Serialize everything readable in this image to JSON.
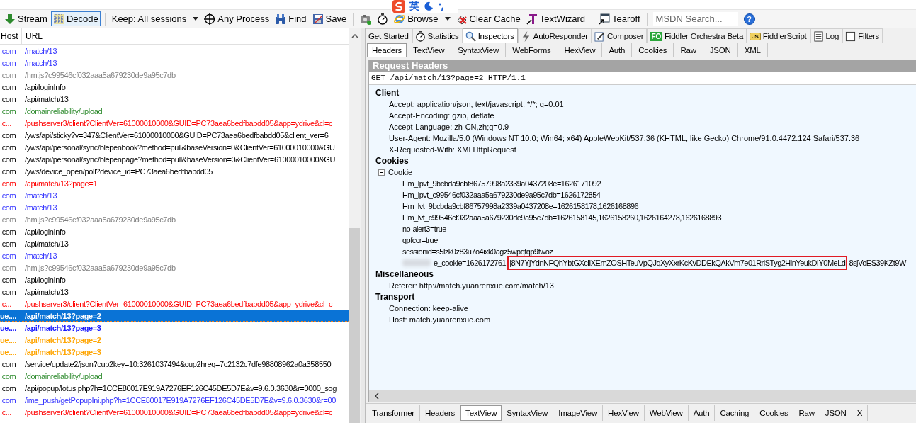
{
  "ime_toolbar": {
    "mode": "英"
  },
  "toolbar": [
    {
      "kind": "button",
      "label": "Stream",
      "selected": false
    },
    {
      "kind": "button",
      "label": "Decode",
      "selected": true
    },
    {
      "kind": "separator"
    },
    {
      "kind": "dropdown",
      "label": "Keep: All sessions"
    },
    {
      "kind": "button",
      "label": "Any Process"
    },
    {
      "kind": "button",
      "label": "Find"
    },
    {
      "kind": "button",
      "label": "Save"
    },
    {
      "kind": "separator"
    },
    {
      "kind": "icon"
    },
    {
      "kind": "icon"
    },
    {
      "kind": "dropdown",
      "label": "Browse"
    },
    {
      "kind": "button",
      "label": "Clear Cache"
    },
    {
      "kind": "button",
      "label": "TextWizard"
    },
    {
      "kind": "separator"
    },
    {
      "kind": "button",
      "label": "Tearoff"
    },
    {
      "kind": "separator"
    },
    {
      "kind": "search",
      "placeholder": "MSDN Search..."
    },
    {
      "kind": "help",
      "label": "?"
    }
  ],
  "sessions": {
    "columns": [
      "Host",
      "URL"
    ],
    "rows": [
      {
        "host": ".com",
        "url": "/match/13",
        "color": "#3333ff",
        "bold": false,
        "selected": false
      },
      {
        "host": ".com",
        "url": "/match/13",
        "color": "#3333ff",
        "bold": false,
        "selected": false
      },
      {
        "host": ".com",
        "url": "/hm.js?c99546cf032aaa5a679230de9a95c7db",
        "color": "#808080",
        "bold": false,
        "selected": false
      },
      {
        "host": ".com",
        "url": "/api/loginInfo",
        "color": "#000000",
        "bold": false,
        "selected": false
      },
      {
        "host": ".com",
        "url": "/api/match/13",
        "color": "#000000",
        "bold": false,
        "selected": false
      },
      {
        "host": ".com",
        "url": "/domainreliability/upload",
        "color": "#2e8b2e",
        "bold": false,
        "selected": false
      },
      {
        "host": ".c...",
        "url": "/pushserver3/client?ClientVer=61000010000&GUID=PC73aea6bedfbabdd05&app=ydrive&cl=c",
        "color": "#ff0000",
        "bold": false,
        "selected": false
      },
      {
        "host": ".com",
        "url": "/yws/api/sticky?v=347&ClientVer=61000010000&GUID=PC73aea6bedfbabdd05&client_ver=6",
        "color": "#000000",
        "bold": false,
        "selected": false
      },
      {
        "host": ".com",
        "url": "/yws/api/personal/sync/blepenbook?method=pull&baseVersion=0&ClientVer=61000010000&GU",
        "color": "#000000",
        "bold": false,
        "selected": false
      },
      {
        "host": ".com",
        "url": "/yws/api/personal/sync/blepenpage?method=pull&baseVersion=0&ClientVer=61000010000&GU",
        "color": "#000000",
        "bold": false,
        "selected": false
      },
      {
        "host": ".com",
        "url": "/yws/device_open/poll?device_id=PC73aea6bedfbabdd05",
        "color": "#000000",
        "bold": false,
        "selected": false
      },
      {
        "host": ".com",
        "url": "/api/match/13?page=1",
        "color": "#ff0000",
        "bold": false,
        "selected": false
      },
      {
        "host": ".com",
        "url": "/match/13",
        "color": "#3333ff",
        "bold": false,
        "selected": false
      },
      {
        "host": ".com",
        "url": "/match/13",
        "color": "#3333ff",
        "bold": false,
        "selected": false
      },
      {
        "host": ".com",
        "url": "/hm.js?c99546cf032aaa5a679230de9a95c7db",
        "color": "#808080",
        "bold": false,
        "selected": false
      },
      {
        "host": ".com",
        "url": "/api/loginInfo",
        "color": "#000000",
        "bold": false,
        "selected": false
      },
      {
        "host": ".com",
        "url": "/api/match/13",
        "color": "#000000",
        "bold": false,
        "selected": false
      },
      {
        "host": ".com",
        "url": "/match/13",
        "color": "#3333ff",
        "bold": false,
        "selected": false
      },
      {
        "host": ".com",
        "url": "/hm.js?c99546cf032aaa5a679230de9a95c7db",
        "color": "#808080",
        "bold": false,
        "selected": false
      },
      {
        "host": ".com",
        "url": "/api/loginInfo",
        "color": "#000000",
        "bold": false,
        "selected": false
      },
      {
        "host": ".com",
        "url": "/api/match/13",
        "color": "#000000",
        "bold": false,
        "selected": false
      },
      {
        "host": ".c...",
        "url": "/pushserver3/client?ClientVer=61000010000&GUID=PC73aea6bedfbabdd05&app=ydrive&cl=c",
        "color": "#ff0000",
        "bold": false,
        "selected": false
      },
      {
        "host": "ue....",
        "url": "/api/match/13?page=2",
        "color": "#ffffff",
        "bold": true,
        "selected": true
      },
      {
        "host": "ue....",
        "url": "/api/match/13?page=3",
        "color": "#1a1aff",
        "bold": true,
        "selected": false
      },
      {
        "host": "ue....",
        "url": "/api/match/13?page=2",
        "color": "#ffa500",
        "bold": true,
        "selected": false
      },
      {
        "host": "ue....",
        "url": "/api/match/13?page=3",
        "color": "#ffa500",
        "bold": true,
        "selected": false
      },
      {
        "host": ".com",
        "url": "/service/update2/json?cup2key=10:3261037494&cup2hreq=7c2132c7dfe98808962a0a358550",
        "color": "#000000",
        "bold": false,
        "selected": false
      },
      {
        "host": ".com",
        "url": "/domainreliability/upload",
        "color": "#2e8b2e",
        "bold": false,
        "selected": false
      },
      {
        "host": ".com",
        "url": "/api/popup/lotus.php?h=1CCE80017E919A7276EF126C45DE5D7E&v=9.6.0.3630&r=0000_sog",
        "color": "#000000",
        "bold": false,
        "selected": false
      },
      {
        "host": ".com",
        "url": "/ime_push/getPopupIni.php?h=1CCE80017E919A7276EF126C45DE5D7E&v=9.6.0.3630&r=00",
        "color": "#3333ff",
        "bold": false,
        "selected": false
      },
      {
        "host": ".c...",
        "url": "/pushserver3/client?ClientVer=61000010000&GUID=PC73aea6bedfbabdd05&app=ydrive&cl=c",
        "color": "#ff0000",
        "bold": false,
        "selected": false
      }
    ]
  },
  "main_tabs": [
    {
      "label": "Get Started",
      "selected": false
    },
    {
      "label": "Statistics",
      "selected": false
    },
    {
      "label": "Inspectors",
      "selected": true
    },
    {
      "label": "AutoResponder",
      "selected": false
    },
    {
      "label": "Composer",
      "selected": false
    },
    {
      "label": "Fiddler Orchestra Beta",
      "icon_text": "FO",
      "selected": false
    },
    {
      "label": "FiddlerScript",
      "icon_text": "JS",
      "selected": false
    },
    {
      "label": "Log",
      "selected": false
    },
    {
      "label": "Filters",
      "selected": false
    }
  ],
  "request_tabs": [
    {
      "label": "Headers",
      "selected": true
    },
    {
      "label": "TextView",
      "selected": false
    },
    {
      "label": "SyntaxView",
      "selected": false
    },
    {
      "label": "WebForms",
      "selected": false
    },
    {
      "label": "HexView",
      "selected": false
    },
    {
      "label": "Auth",
      "selected": false
    },
    {
      "label": "Cookies",
      "selected": false
    },
    {
      "label": "Raw",
      "selected": false
    },
    {
      "label": "JSON",
      "selected": false
    },
    {
      "label": "XML",
      "selected": false
    }
  ],
  "request_headers": {
    "title": "Request Headers",
    "request_line": "GET /api/match/13?page=2 HTTP/1.1",
    "groups": [
      {
        "name": "Client",
        "items": [
          {
            "text": "Accept: application/json, text/javascript, */*; q=0.01"
          },
          {
            "text": "Accept-Encoding: gzip, deflate"
          },
          {
            "text": "Accept-Language: zh-CN,zh;q=0.9"
          },
          {
            "text": "User-Agent: Mozilla/5.0 (Windows NT 10.0; Win64; x64) AppleWebKit/537.36 (KHTML, like Gecko) Chrome/91.0.4472.124 Safari/537.36"
          },
          {
            "text": "X-Requested-With: XMLHttpRequest"
          }
        ]
      },
      {
        "name": "Cookies",
        "items": [
          {
            "text": "Cookie",
            "expanded": true,
            "children": [
              {
                "text": "Hm_lpvt_9bcbda9cbf86757998a2339a0437208e=1626171092"
              },
              {
                "text": "Hm_lpvt_c99546cf032aaa5a679230de9a95c7db=1626172854"
              },
              {
                "text": "Hm_lvt_9bcbda9cbf86757998a2339a0437208e=1626158178,1626168896"
              },
              {
                "text": "Hm_lvt_c99546cf032aaa5a679230de9a95c7db=1626158145,1626158260,1626164278,1626168893"
              },
              {
                "text": "no-alert3=true"
              },
              {
                "text": "qpfccr=true"
              },
              {
                "text": "sessionid=s5lzk0z83u7o4ixk0agz5wpqfqp9twoz"
              },
              {
                "text": "e_cookie=1626172761",
                "redacted": true,
                "highlight": "|8N7YjYdnNFQhYbtGXciIXEmZOSHTeuVpQJqXyXxrKcKvDDEkQAkVm7e01RriSTyg2HlnYeukDIY0MeLd",
                "rest": "8sjVoES39KZt9W"
              }
            ]
          }
        ]
      },
      {
        "name": "Miscellaneous",
        "items": [
          {
            "text": "Referer: http://match.yuanrenxue.com/match/13"
          }
        ]
      },
      {
        "name": "Transport",
        "items": [
          {
            "text": "Connection: keep-alive"
          },
          {
            "text": "Host: match.yuanrenxue.com"
          }
        ]
      }
    ]
  },
  "response_tabs": [
    {
      "label": "Transformer",
      "selected": false
    },
    {
      "label": "Headers",
      "selected": false
    },
    {
      "label": "TextView",
      "selected": true
    },
    {
      "label": "SyntaxView",
      "selected": false
    },
    {
      "label": "ImageView",
      "selected": false
    },
    {
      "label": "HexView",
      "selected": false
    },
    {
      "label": "WebView",
      "selected": false
    },
    {
      "label": "Auth",
      "selected": false
    },
    {
      "label": "Caching",
      "selected": false
    },
    {
      "label": "Cookies",
      "selected": false
    },
    {
      "label": "Raw",
      "selected": false
    },
    {
      "label": "JSON",
      "selected": false
    },
    {
      "label": "X",
      "selected": false
    }
  ]
}
